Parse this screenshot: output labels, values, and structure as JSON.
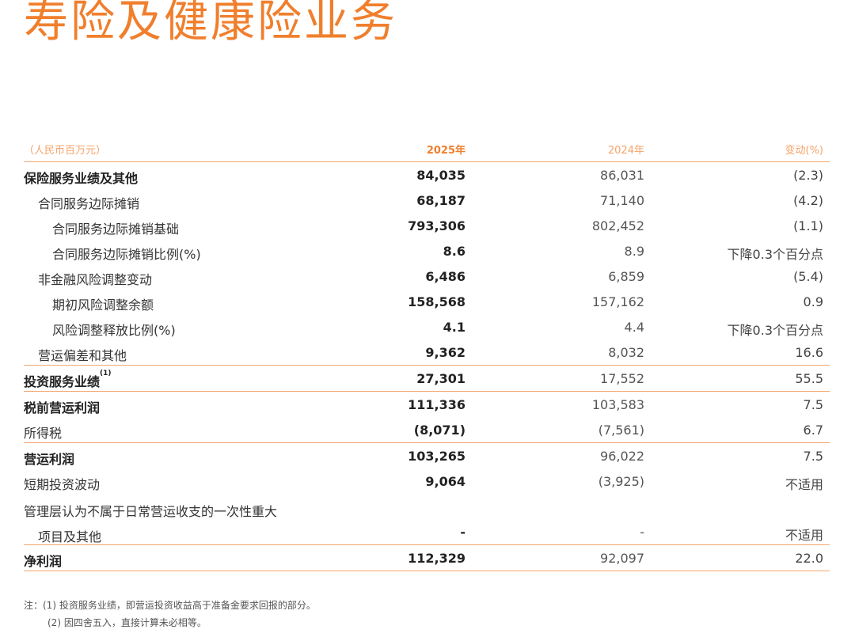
{
  "title": "寿险及健康险业务",
  "header": {
    "unit": "（人民币百万元）",
    "y2025": "2025年",
    "y2024": "2024年",
    "change": "变动(%)"
  },
  "rows": [
    {
      "label": "保险服务业绩及其他",
      "v2025": "84,035",
      "v2024": "86,031",
      "change": "(2.3)"
    },
    {
      "label": "合同服务边际摊销",
      "v2025": "68,187",
      "v2024": "71,140",
      "change": "(4.2)"
    },
    {
      "label": "合同服务边际摊销基础",
      "v2025": "793,306",
      "v2024": "802,452",
      "change": "(1.1)"
    },
    {
      "label": "合同服务边际摊销比例(%)",
      "v2025": "8.6",
      "v2024": "8.9",
      "change": "下降0.3个百分点"
    },
    {
      "label": "非金融风险调整变动",
      "v2025": "6,486",
      "v2024": "6,859",
      "change": "(5.4)"
    },
    {
      "label": "期初风险调整余额",
      "v2025": "158,568",
      "v2024": "157,162",
      "change": "0.9"
    },
    {
      "label": "风险调整释放比例(%)",
      "v2025": "4.1",
      "v2024": "4.4",
      "change": "下降0.3个百分点"
    },
    {
      "label": "营运偏差和其他",
      "v2025": "9,362",
      "v2024": "8,032",
      "change": "16.6"
    },
    {
      "label": "投资服务业绩",
      "sup": "(1)",
      "v2025": "27,301",
      "v2024": "17,552",
      "change": "55.5"
    },
    {
      "label": "税前营运利润",
      "v2025": "111,336",
      "v2024": "103,583",
      "change": "7.5"
    },
    {
      "label": "所得税",
      "v2025": "(8,071)",
      "v2024": "(7,561)",
      "change": "6.7"
    },
    {
      "label": "营运利润",
      "v2025": "103,265",
      "v2024": "96,022",
      "change": "7.5"
    },
    {
      "label": "短期投资波动",
      "v2025": "9,064",
      "v2024": "(3,925)",
      "change": "不适用"
    },
    {
      "label_line1": "管理层认为不属于日常营运收支的一次性重大",
      "label_line2": "项目及其他",
      "v2025": "-",
      "v2024": "-",
      "change": "不适用"
    },
    {
      "label": "净利润",
      "v2025": "112,329",
      "v2024": "92,097",
      "change": "22.0"
    }
  ],
  "notes": [
    "注：(1) 投资服务业绩，即营运投资收益高于准备金要求回报的部分。",
    "(2) 因四舍五入，直接计算未必相等。"
  ],
  "colors": {
    "accent": "#f07f2d",
    "rule": "#f3a56a"
  }
}
